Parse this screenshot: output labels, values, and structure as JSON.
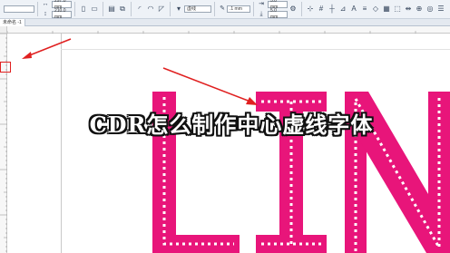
{
  "toolbar": {
    "width_value": "297.0 mm",
    "height_value": "210.0 mm",
    "style_value": "虚线",
    "outline_width": ".1 mm",
    "offset_x": "5.0 mm",
    "offset_y": "5.0 mm",
    "icons": [
      "portrait-icon",
      "landscape-icon",
      "align-left-icon",
      "align-center-icon",
      "fill-icon",
      "outline-icon",
      "corner-icon",
      "dash-icon",
      "start-arrow-icon",
      "end-arrow-icon",
      "wrap-icon",
      "text-icon",
      "pen-icon",
      "grid-icon",
      "dimension-icon",
      "snap-icon",
      "settings-icon"
    ]
  },
  "document": {
    "tab_label": "未命名 -1"
  },
  "ruler": {
    "top_ticks": [
      "0"
    ],
    "left_ticks": [
      "0"
    ]
  },
  "canvas": {
    "text_art": "LIN",
    "fill_color": "#e8157a",
    "dash_color": "#ffffff"
  },
  "overlay": {
    "title": "CDR怎么制作中心虚线字体",
    "arrow_color": "#e02020"
  }
}
